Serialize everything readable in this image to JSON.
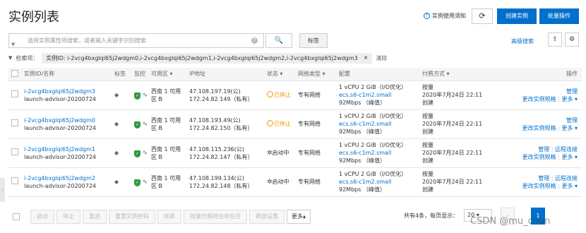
{
  "header": {
    "title": "实例列表",
    "help_link": "实例使用须知",
    "refresh_glyph": "⟳",
    "create_label": "创建实例",
    "batch_label": "批量操作"
  },
  "search": {
    "placeholder": "选择实例属性项搜索，或者输入关键字识别搜索",
    "search_glyph": "🔍",
    "tag_label": "标签",
    "advanced_label": "高级搜索",
    "clear_glyph": "×"
  },
  "filter": {
    "label": "检索项：",
    "chip_text": "实例ID: i-2vcg4bxglqi65j2wdgm0,i-2vcg4bxglqi65j2wdgm1,i-2vcg4bxglqi65j2wdgm2,i-2vcg4bxglqi65j2wdgm3",
    "chip_close": "×",
    "clear_label": "清除"
  },
  "columns": {
    "name": "实例ID/名称",
    "tag": "标签",
    "monitor": "监控",
    "zone": "可用区 ▾",
    "ip": "IP地址",
    "status": "状态 ▾",
    "network": "网络类型 ▾",
    "config": "配置",
    "billing": "付费方式 ▾",
    "ops": "操作"
  },
  "rows": [
    {
      "id": "i-2vcg4bxglqi65j2wdgm3",
      "name": "launch-advisor-20200724",
      "zone_1": "西南 1 可用",
      "zone_2": "区 B",
      "ip_public": "47.108.197.19(公)",
      "ip_private": "172.24.82.149（私有）",
      "status": "已停止",
      "network": "专有网络",
      "cpu": "1 vCPU 2 GiB（I/O优化）",
      "spec": "ecs.s6-c1m2.small",
      "bw": "92Mbps （峰值）",
      "billing": "按量",
      "created_1": "2020年7月24日 22:11",
      "created_2": "创建",
      "op_1": "管理",
      "op_2": "更改实例规格",
      "op_3": "更多 ▾"
    },
    {
      "id": "i-2vcg4bxglqi65j2wdgm0",
      "name": "launch-advisor-20200724",
      "zone_1": "西南 1 可用",
      "zone_2": "区 B",
      "ip_public": "47.108.193.49(公)",
      "ip_private": "172.24.82.150（私有）",
      "status": "已停止",
      "network": "专有网络",
      "cpu": "1 vCPU 2 GiB（I/O优化）",
      "spec": "ecs.s6-c1m2.small",
      "bw": "92Mbps （峰值）",
      "billing": "按量",
      "created_1": "2020年7月24日 22:11",
      "created_2": "创建",
      "op_1": "管理",
      "op_2": "更改实例规格",
      "op_3": "更多 ▾"
    },
    {
      "id": "i-2vcg4bxglqi65j2wdgm1",
      "name": "launch-advisor-20200724",
      "zone_1": "西南 1 可用",
      "zone_2": "区 B",
      "ip_public": "47.108.115.236(公)",
      "ip_private": "172.24.82.147（私有）",
      "status": "启动中",
      "network": "专有网络",
      "cpu": "1 vCPU 2 GiB（I/O优化）",
      "spec": "ecs.s6-c1m2.small",
      "bw": "92Mbps （峰值）",
      "billing": "按量",
      "created_1": "2020年7月24日 22:11",
      "created_2": "创建",
      "op_1": "管理",
      "op_1b": "远程连接",
      "op_2": "更改实例规格",
      "op_3": "更多 ▾"
    },
    {
      "id": "i-2vcg4bxglqi65j2wdgm2",
      "name": "launch-advisor-20200724",
      "zone_1": "西南 1 可用",
      "zone_2": "区 B",
      "ip_public": "47.108.199.134(公)",
      "ip_private": "172.24.82.148（私有）",
      "status": "启动中",
      "network": "专有网络",
      "cpu": "1 vCPU 2 GiB（I/O优化）",
      "spec": "ecs.s6-c1m2.small",
      "bw": "92Mbps （峰值）",
      "billing": "按量",
      "created_1": "2020年7月24日 22:11",
      "created_2": "创建",
      "op_1": "管理",
      "op_1b": "远程连接",
      "op_2": "更改实例规格",
      "op_3": "更多 ▾"
    }
  ],
  "bulk": {
    "start": "启动",
    "stop": "停止",
    "restart": "重启",
    "reset_pwd": "重置实例密码",
    "renew": "续费",
    "convert": "按量付费转包年包月",
    "release": "释放设置",
    "more": "更多▴"
  },
  "pagination": {
    "total": "共有4条，每页显示：",
    "page_size": "20 ▾",
    "prev": "‹",
    "current": "1"
  },
  "watermark": "CSDN @mu_chun",
  "colors": {
    "primary": "#0070cc",
    "stopped": "#f39800",
    "shield": "#2e9a3e"
  }
}
